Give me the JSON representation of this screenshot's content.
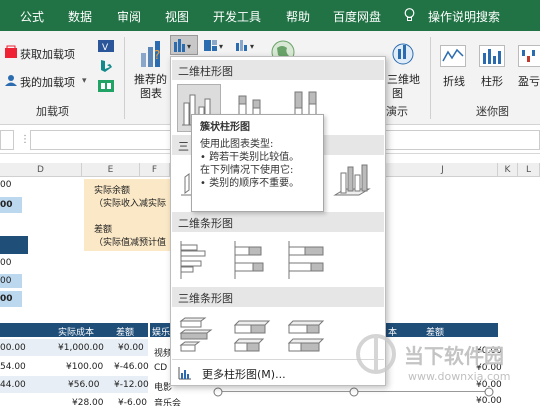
{
  "tabs": [
    "公式",
    "数据",
    "审阅",
    "视图",
    "开发工具",
    "帮助",
    "百度网盘",
    "操作说明搜索"
  ],
  "ribbon": {
    "get_addins": "获取加载项",
    "my_addins": "我的加载项",
    "addins_group": "加载项",
    "recommended_charts": [
      "推荐的",
      "图表"
    ],
    "map3d": [
      "三维地",
      "图"
    ],
    "tours_group": "演示",
    "sparkline_line": "折线",
    "sparkline_column": "柱形",
    "sparkline_winloss": "盈亏",
    "sparklines_group": "迷你图"
  },
  "columns": [
    "D",
    "E",
    "F",
    "J",
    "K",
    "L"
  ],
  "sheet": {
    "left_values": [
      "00",
      "00",
      "00",
      "00",
      "00"
    ],
    "note_lines": [
      "实际余额",
      "（实际收入减实际",
      "差额",
      "（实际值减预计值"
    ],
    "table_header": [
      "实际成本",
      "差额"
    ],
    "rows": [
      [
        "00.00",
        "¥1,000.00",
        "¥0.00"
      ],
      [
        "54.00",
        "¥100.00",
        "¥-46.00"
      ],
      [
        "44.00",
        "¥56.00",
        "¥-12.00"
      ],
      [
        "",
        "¥28.00",
        "¥-6.00"
      ]
    ],
    "right_header": [
      "娱乐",
      "本",
      "差额"
    ],
    "right_rows": [
      [
        "视频",
        "¥0.00"
      ],
      [
        "CD",
        "¥0.00"
      ],
      [
        "电影",
        "¥0.00"
      ],
      [
        "音乐会",
        "¥0.00"
      ]
    ]
  },
  "gallery": {
    "section_2d_column": "二维柱形图",
    "section_3d_column_partial": "三",
    "section_2d_bar": "二维条形图",
    "section_3d_bar": "三维条形图",
    "more_charts": "更多柱形图(M)..."
  },
  "tooltip": {
    "title": "簇状柱形图",
    "desc": "使用此图表类型:",
    "bullet1": "• 跨若干类别比较值。",
    "when": "在下列情况下使用它:",
    "bullet2": "• 类别的顺序不重要。"
  },
  "watermark": {
    "text": "当下软件园",
    "url": "www.downxia.com"
  },
  "colors": {
    "excel_green": "#217346",
    "navy": "#1f4e79",
    "light_blue": "#bcd8ef",
    "note": "#fbe8c6"
  }
}
